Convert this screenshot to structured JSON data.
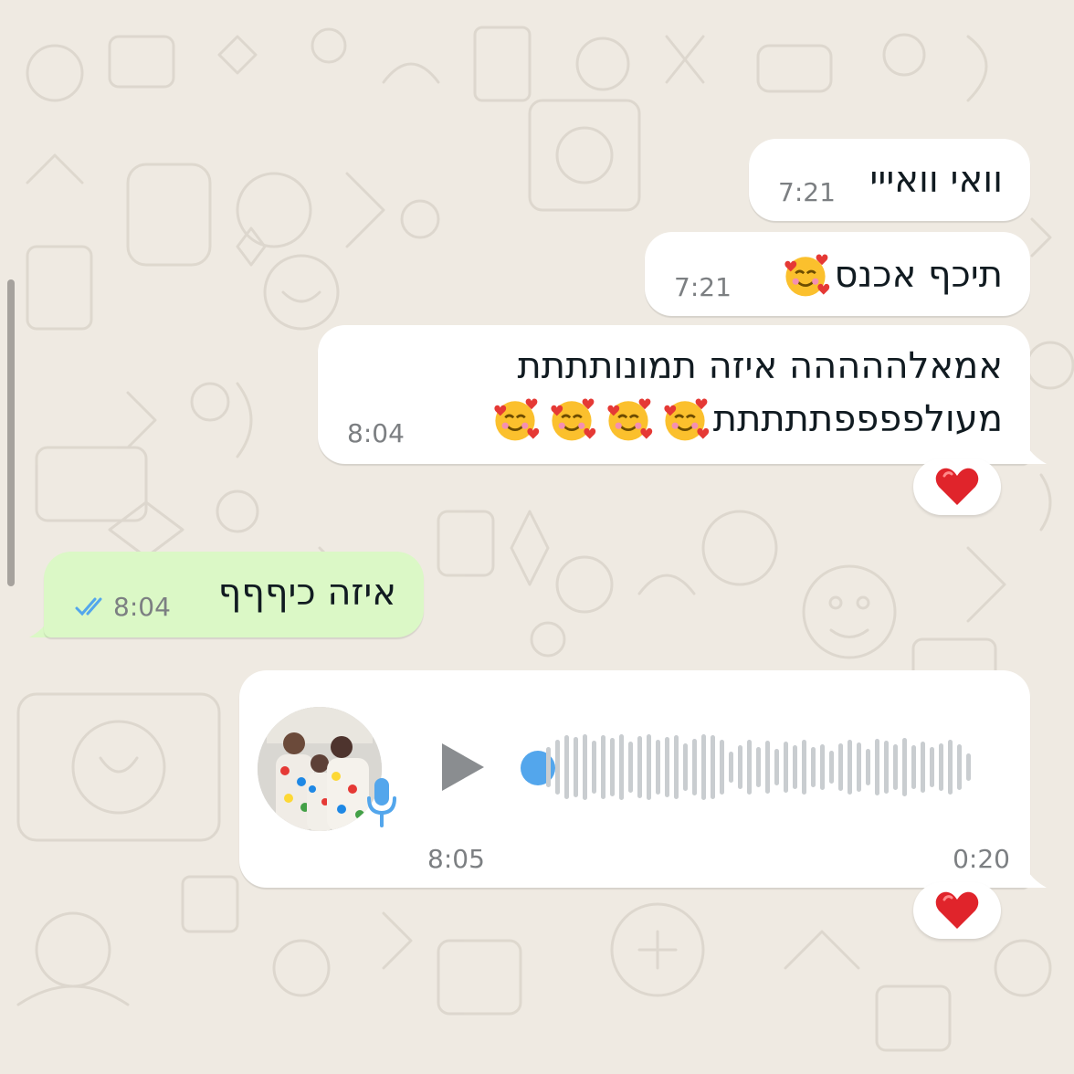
{
  "chat": {
    "messages": [
      {
        "direction": "in",
        "text": "וואי וואייי",
        "time": "7:21"
      },
      {
        "direction": "in",
        "text": "תיכף אכנס",
        "time": "7:21"
      },
      {
        "direction": "in",
        "text_line1": "אמאלההההה איזה תמונותתתת",
        "text_line2": "מעולפפפפתתתתת",
        "time": "8:04",
        "reaction": "red-heart"
      },
      {
        "direction": "out",
        "text": "איזה כיףףף",
        "time": "8:04",
        "status": "read"
      },
      {
        "direction": "in",
        "type": "voice",
        "time": "8:05",
        "duration": "0:20",
        "progress": 0,
        "reaction": "red-heart"
      }
    ]
  },
  "colors": {
    "wallpaper": "#efeae2",
    "incoming_bubble": "#ffffff",
    "outgoing_bubble": "#dbf8c6",
    "read_ticks": "#53a6ec",
    "voice_dot": "#53a6ec",
    "time_text": "#7c7f82"
  },
  "icons": {
    "emoji": "smiling-face-with-hearts-icon",
    "reaction": "red-heart-icon",
    "ticks": "double-check-icon",
    "play": "play-icon",
    "mic": "microphone-icon"
  }
}
